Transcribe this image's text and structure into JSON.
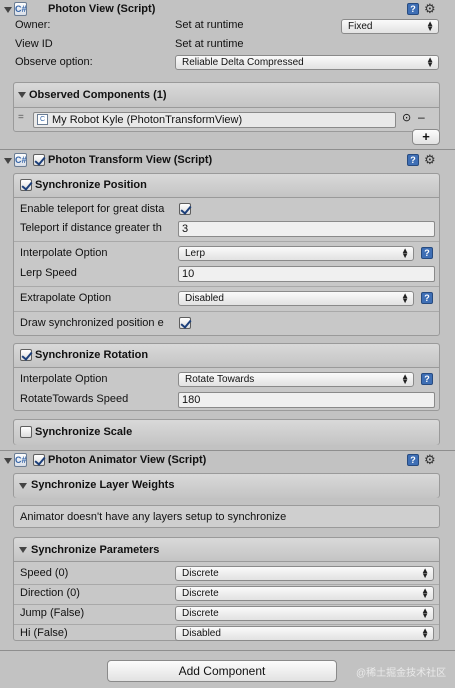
{
  "photon_view": {
    "title": "Photon View (Script)",
    "owner_label": "Owner:",
    "owner_value": "Set at runtime",
    "owner_option": "Fixed",
    "view_id_label": "View ID",
    "view_id_value": "Set at runtime",
    "observe_label": "Observe option:",
    "observe_value": "Reliable Delta Compressed",
    "observed_title": "Observed Components (1)",
    "observed_item": "My Robot Kyle (PhotonTransformView)",
    "remove_symbol": "–",
    "add_symbol": "+",
    "target_symbol": "⊙"
  },
  "transform_view": {
    "title": "Photon Transform View (Script)",
    "enabled": true,
    "position": {
      "title": "Synchronize Position",
      "checked": true,
      "teleport_label": "Enable teleport for great dista",
      "teleport_checked": true,
      "teleport_distance_label": "Teleport if distance greater th",
      "teleport_distance_value": "3",
      "interpolate_label": "Interpolate Option",
      "interpolate_value": "Lerp",
      "lerp_speed_label": "Lerp Speed",
      "lerp_speed_value": "10",
      "extrapolate_label": "Extrapolate Option",
      "extrapolate_value": "Disabled",
      "draw_label": "Draw synchronized position e",
      "draw_checked": true
    },
    "rotation": {
      "title": "Synchronize Rotation",
      "checked": true,
      "interpolate_label": "Interpolate Option",
      "interpolate_value": "Rotate Towards",
      "speed_label": "RotateTowards Speed",
      "speed_value": "180"
    },
    "scale": {
      "title": "Synchronize Scale",
      "checked": false
    }
  },
  "animator_view": {
    "title": "Photon Animator View (Script)",
    "enabled": true,
    "layer_weights_title": "Synchronize Layer Weights",
    "layers_message": "Animator doesn't have any layers setup to synchronize",
    "parameters_title": "Synchronize Parameters",
    "parameters": [
      {
        "label": "Speed (0)",
        "value": "Discrete"
      },
      {
        "label": "Direction (0)",
        "value": "Discrete"
      },
      {
        "label": "Jump (False)",
        "value": "Discrete"
      },
      {
        "label": "Hi (False)",
        "value": "Disabled"
      }
    ]
  },
  "add_component_label": "Add Component",
  "watermark": "@稀土掘金技术社区",
  "icons": {
    "help": "?",
    "gear": "⚙",
    "script": "C#",
    "arrow": "▲▼"
  }
}
